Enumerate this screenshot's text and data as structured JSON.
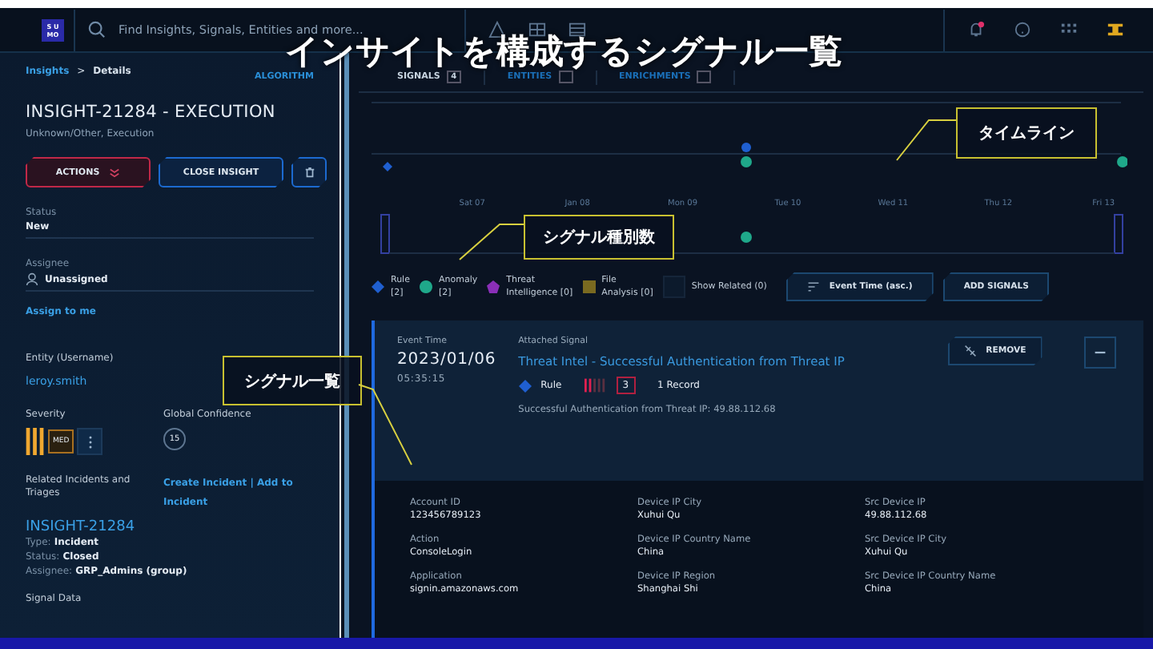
{
  "header": {
    "logo": [
      "S U",
      "MO"
    ],
    "search": {
      "placeholder": "Find Insights, Signals, Entities and more..."
    }
  },
  "details": {
    "breadcrumb": [
      "Insights",
      "Details"
    ],
    "breadcrumb_separator": ">",
    "algorithm": "ALGORITHM",
    "title": "INSIGHT-21284 - EXECUTION",
    "subtitle": "Unknown/Other, Execution",
    "buttons": [
      {
        "label": "ACTIONS",
        "kind": "danger"
      },
      {
        "label": "CLOSE INSIGHT",
        "kind": "primary"
      }
    ],
    "status": {
      "label": "Status",
      "value": "New"
    },
    "assignee": {
      "label": "Assignee",
      "value": "Unassigned"
    },
    "assign_link": "Assign to me",
    "entity": {
      "label": "Entity (Username)",
      "value": "leroy.smith"
    },
    "severity": {
      "label": "Severity",
      "value": "MED"
    },
    "confidence": {
      "label": "Global Confidence",
      "value": "15"
    },
    "related": {
      "label": "Related Incidents and Triages",
      "link": "Create Incident | Add to Incident",
      "incident": "INSIGHT-21284",
      "facts": [
        {
          "key": "Type:",
          "value": "Incident"
        },
        {
          "key": "Status:",
          "value": "Closed"
        },
        {
          "key": "Assignee:",
          "value": "GRP_Admins (group)"
        }
      ]
    },
    "signal_data": "Signal Data"
  },
  "tabs": [
    {
      "label": "SIGNALS",
      "count": "4",
      "selected": true
    },
    {
      "label": "ENTITIES",
      "selected": false
    },
    {
      "label": "ENRICHMENTS",
      "selected": false
    }
  ],
  "timeline": {
    "days": [
      "Sat 07",
      "Jan 08",
      "Mon 09",
      "Tue 10",
      "Wed 11",
      "Thu 12",
      "Fri 13"
    ]
  },
  "legend": [
    {
      "label": "Rule\n[2]",
      "kind": "diamond",
      "color": "#1f5fd0"
    },
    {
      "label": "Anomaly\n[2]",
      "kind": "circle",
      "color": "#1fa88a"
    },
    {
      "label": "Threat\nIntelligence [0]",
      "kind": "pentagon",
      "color": "#8a2fb8"
    },
    {
      "label": "File\nAnalysis [0]",
      "kind": "square",
      "color": "#7a6a20"
    }
  ],
  "show_related": {
    "label": "Show Related (0)",
    "checked": false
  },
  "sort_button": "Event Time (asc.)",
  "add_button": "ADD SIGNALS",
  "signal": {
    "event_time_label": "Event Time",
    "date": "2023/01/06",
    "time": "05:35:15",
    "attached_label": "Attached Signal",
    "title": "Threat Intel - Successful Authentication from Threat IP",
    "kind": "Rule",
    "severity": "3",
    "records": "1 Record",
    "description": "Successful Authentication from Threat IP: 49.88.112.68",
    "remove": "REMOVE",
    "fields": [
      {
        "label": "Account ID",
        "value": "123456789123"
      },
      {
        "label": "Device IP City",
        "value": "Xuhui Qu"
      },
      {
        "label": "Src Device IP",
        "value": "49.88.112.68"
      },
      {
        "label": "Action",
        "value": "ConsoleLogin"
      },
      {
        "label": "Device IP Country Name",
        "value": "China"
      },
      {
        "label": "Src Device IP City",
        "value": "Xuhui Qu"
      },
      {
        "label": "Application",
        "value": "signin.amazonaws.com"
      },
      {
        "label": "Device IP Region",
        "value": "Shanghai Shi"
      },
      {
        "label": "Src Device IP Country Name",
        "value": "China"
      }
    ]
  },
  "overlay": {
    "title": "インサイトを構成するシグナル一覧",
    "callouts": [
      "タイムライン",
      "シグナル種別数",
      "シグナル一覧"
    ]
  }
}
